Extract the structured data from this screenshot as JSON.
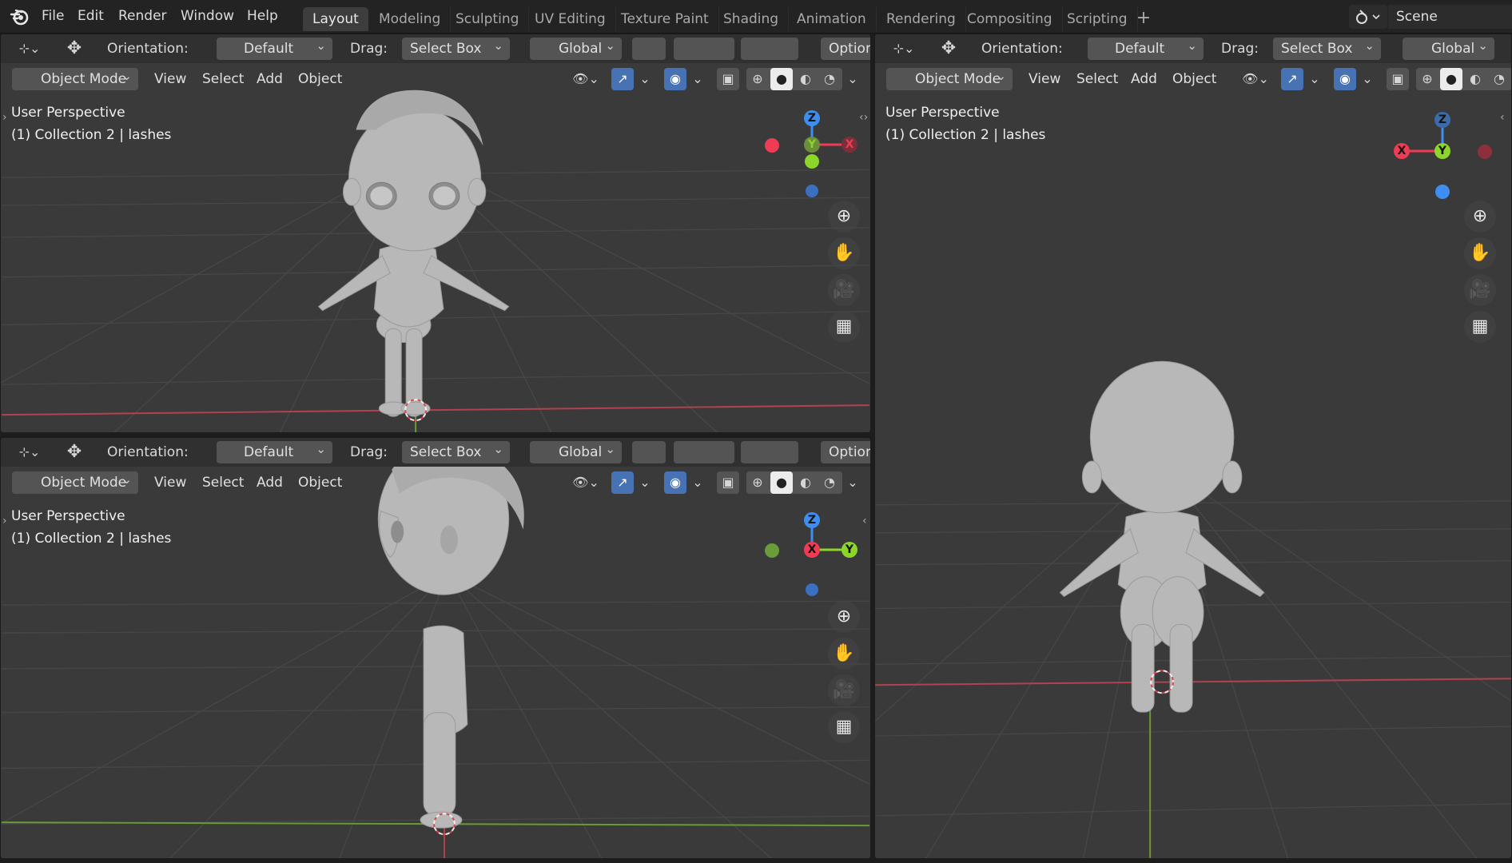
{
  "topbar": {
    "menus": [
      "File",
      "Edit",
      "Render",
      "Window",
      "Help"
    ],
    "workspaces": [
      "Layout",
      "Modeling",
      "Sculpting",
      "UV Editing",
      "Texture Paint",
      "Shading",
      "Animation",
      "Rendering",
      "Compositing",
      "Scripting"
    ],
    "active_workspace": "Layout",
    "scene_name": "Scene"
  },
  "viewport_header": {
    "orientation_label": "Orientation:",
    "orientation_value": "Default",
    "drag_label": "Drag:",
    "drag_value": "Select Box",
    "transform_space": "Global",
    "options_label": "Options",
    "mode": "Object Mode",
    "menus": [
      "View",
      "Select",
      "Add",
      "Object"
    ]
  },
  "viewports": {
    "top_left": {
      "view_name": "User Perspective",
      "collection": "(1) Collection 2 | lashes"
    },
    "bottom_left": {
      "view_name": "User Perspective",
      "collection": "(1) Collection 2 | lashes"
    },
    "right": {
      "view_name": "User Perspective",
      "collection": "(1) Collection 2 | lashes"
    }
  },
  "gizmo": {
    "x": "X",
    "y": "Y",
    "z": "Z"
  },
  "colors": {
    "x_axis": "#ee3c54",
    "y_axis": "#8cd52b",
    "z_axis": "#3d8ef0",
    "accent_blue": "#4772b3",
    "viewport_bg": "#3a3a3a"
  }
}
